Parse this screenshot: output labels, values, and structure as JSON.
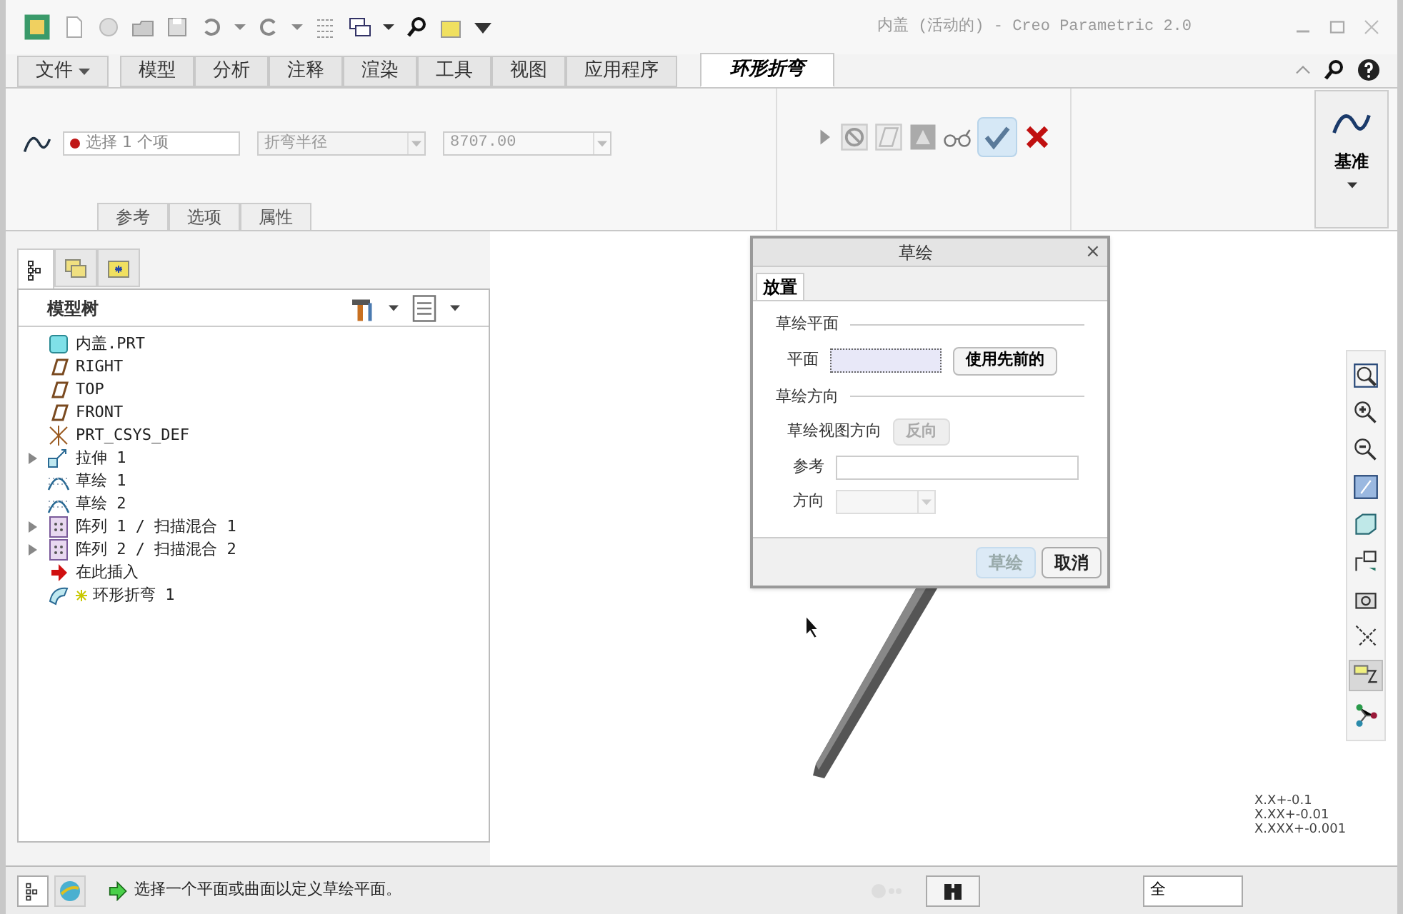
{
  "window": {
    "title": "内盖 (活动的) - Creo Parametric 2.0"
  },
  "ribbon_tabs": [
    {
      "label": "文件",
      "kind": "file",
      "selected": false
    },
    {
      "label": "模型",
      "kind": "tab",
      "selected": false
    },
    {
      "label": "分析",
      "kind": "tab",
      "selected": false
    },
    {
      "label": "注释",
      "kind": "tab",
      "selected": false
    },
    {
      "label": "渲染",
      "kind": "tab",
      "selected": false
    },
    {
      "label": "工具",
      "kind": "tab",
      "selected": false
    },
    {
      "label": "视图",
      "kind": "tab",
      "selected": false
    },
    {
      "label": "应用程序",
      "kind": "tab",
      "selected": false
    },
    {
      "label": "环形折弯",
      "kind": "tab",
      "selected": true
    }
  ],
  "dashboard": {
    "collector": "选择 1 个项",
    "bend_type": "折弯半径",
    "radius": "8707.00",
    "panels": [
      {
        "label": "参考"
      },
      {
        "label": "选项"
      },
      {
        "label": "属性"
      }
    ],
    "datum_button": "基准"
  },
  "model_tree": {
    "title": "模型树",
    "root": {
      "label": "内盖.PRT",
      "kind": "part",
      "children": [
        {
          "label": "RIGHT",
          "kind": "plane"
        },
        {
          "label": "TOP",
          "kind": "plane"
        },
        {
          "label": "FRONT",
          "kind": "plane"
        },
        {
          "label": "PRT_CSYS_DEF",
          "kind": "csys"
        },
        {
          "label": "拉伸 1",
          "kind": "extrude",
          "expanded": false
        },
        {
          "label": "草绘 1",
          "kind": "sketch"
        },
        {
          "label": "草绘 2",
          "kind": "sketch"
        },
        {
          "label": "阵列 1 / 扫描混合 1",
          "kind": "pattern",
          "expanded": false
        },
        {
          "label": "阵列 2 / 扫描混合 2",
          "kind": "pattern",
          "expanded": false
        },
        {
          "label": "在此插入",
          "kind": "insert"
        },
        {
          "label": "环形折弯 1",
          "kind": "toroidal"
        }
      ]
    }
  },
  "dialog": {
    "title": "草绘",
    "close": "×",
    "tabs": [
      {
        "label": "放置",
        "selected": true
      }
    ],
    "plane_section": "草绘平面",
    "plane_label": "平面",
    "use_previous": "使用先前的",
    "orientation_section": "草绘方向",
    "view_direction_label": "草绘视图方向",
    "flip": "反向",
    "flip_disabled": true,
    "reference_label": "参考",
    "direction_label": "方向",
    "buttons": [
      {
        "label": "草绘",
        "disabled": true
      },
      {
        "label": "取消",
        "disabled": false
      }
    ]
  },
  "tolerances": [
    "X.X+-0.1",
    "X.XX+-0.01",
    "X.XXX+-0.001"
  ],
  "status_bar": {
    "message": "选择一个平面或曲面以定义草绘平面。",
    "filter": "全"
  }
}
